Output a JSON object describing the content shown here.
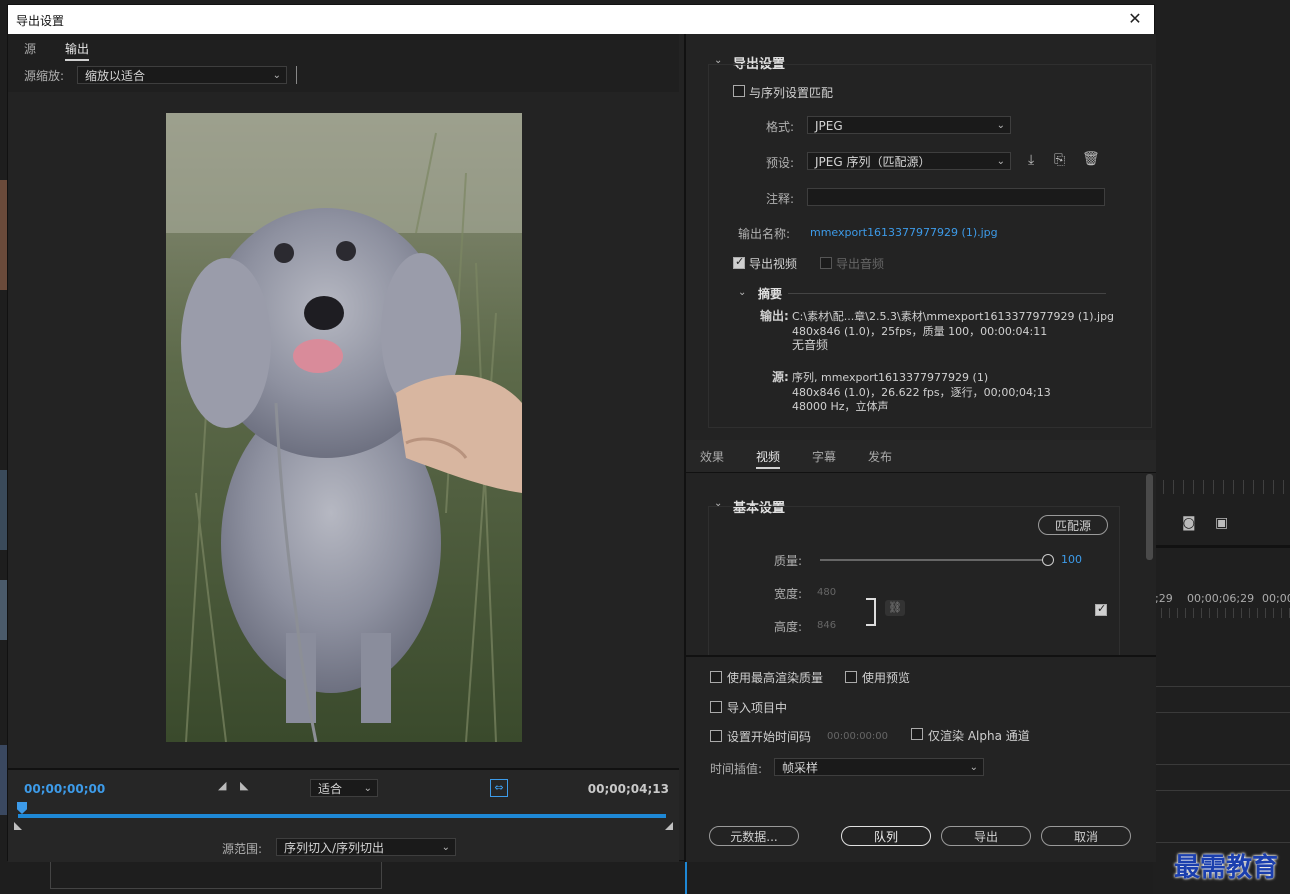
{
  "dialog": {
    "title": "导出设置",
    "close": "✕"
  },
  "left": {
    "tabs": [
      "源",
      "输出"
    ],
    "source_scale_label": "源缩放:",
    "source_scale_value": "缩放以适合",
    "timecode_start": "00;00;00;00",
    "timecode_end": "00;00;04;13",
    "fit_value": "适合",
    "source_range_label": "源范围:",
    "source_range_value": "序列切入/序列切出"
  },
  "export_settings": {
    "section": "导出设置",
    "match_sequence": "与序列设置匹配",
    "format_label": "格式:",
    "format_value": "JPEG",
    "preset_label": "预设:",
    "preset_value": "JPEG 序列（匹配源）",
    "comment_label": "注释:",
    "output_name_label": "输出名称:",
    "output_name_value": "mmexport1613377977929 (1).jpg",
    "export_video": "导出视频",
    "export_audio": "导出音频",
    "summary": {
      "title": "摘要",
      "output_label": "输出:",
      "output_lines": [
        "C:\\素材\\配...章\\2.5.3\\素材\\mmexport1613377977929 (1).jpg",
        "480x846 (1.0)，25fps，质量 100，00:00:04:11",
        "无音频"
      ],
      "source_label": "源:",
      "source_lines": [
        "序列, mmexport1613377977929 (1)",
        "480x846 (1.0)，26.622 fps，逐行，00;00;04;13",
        "48000 Hz，立体声"
      ]
    }
  },
  "tabs2": [
    "效果",
    "视频",
    "字幕",
    "发布"
  ],
  "basic": {
    "section": "基本设置",
    "match_source_btn": "匹配源",
    "quality_label": "质量:",
    "quality_value": "100",
    "quality_fraction": 1.0,
    "width_label": "宽度:",
    "width_value": "480",
    "height_label": "高度:",
    "height_value": "846"
  },
  "bottom": {
    "max_render": "使用最高渲染质量",
    "use_preview": "使用预览",
    "import_project": "导入项目中",
    "set_start_tc": "设置开始时间码",
    "start_tc_value": "00:00:00:00",
    "alpha_only": "仅渲染 Alpha 通道",
    "interp_label": "时间插值:",
    "interp_value": "帧采样",
    "metadata_btn": "元数据...",
    "queue_btn": "队列",
    "export_btn": "导出",
    "cancel_btn": "取消"
  },
  "background": {
    "tc1": ";29",
    "tc2": "00;00;06;29",
    "tc3": "00;00"
  },
  "watermark": "最需教育"
}
